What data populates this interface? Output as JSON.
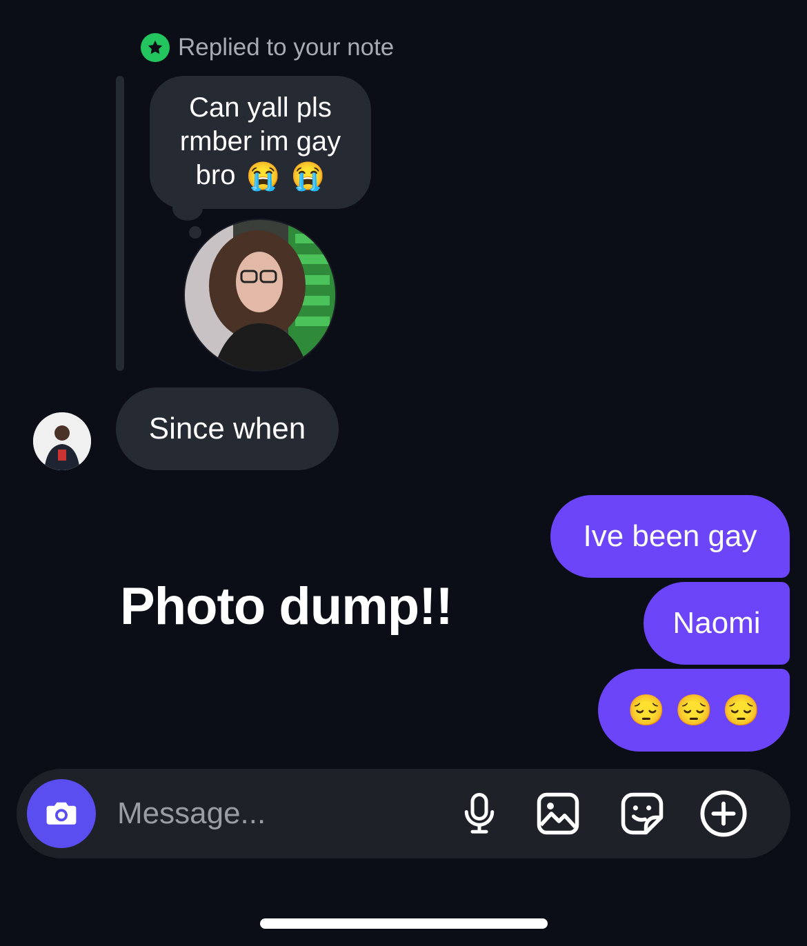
{
  "reply_context": {
    "label": "Replied to your note"
  },
  "note": {
    "lines": [
      "Can yall pls",
      "rmber im gay",
      "bro"
    ],
    "emoji": [
      "😭",
      "😭"
    ]
  },
  "messages": {
    "incoming": [
      {
        "text": "Since when"
      }
    ],
    "outgoing": [
      {
        "text": "Ive been gay"
      },
      {
        "text": "Naomi"
      },
      {
        "text": "😔😔😔",
        "emoji": [
          "😔",
          "😔",
          "😔"
        ]
      }
    ]
  },
  "overlay_text": "Photo dump!!",
  "composer": {
    "placeholder": "Message...",
    "icons": [
      "camera-icon",
      "microphone-icon",
      "image-icon",
      "sticker-icon",
      "plus-circle-icon"
    ]
  },
  "colors": {
    "background": "#0b0e16",
    "incoming_bubble": "#262a33",
    "outgoing_bubble": "#6b45f7",
    "camera_button": "#5b4ef0",
    "note_badge": "#22c55e"
  }
}
